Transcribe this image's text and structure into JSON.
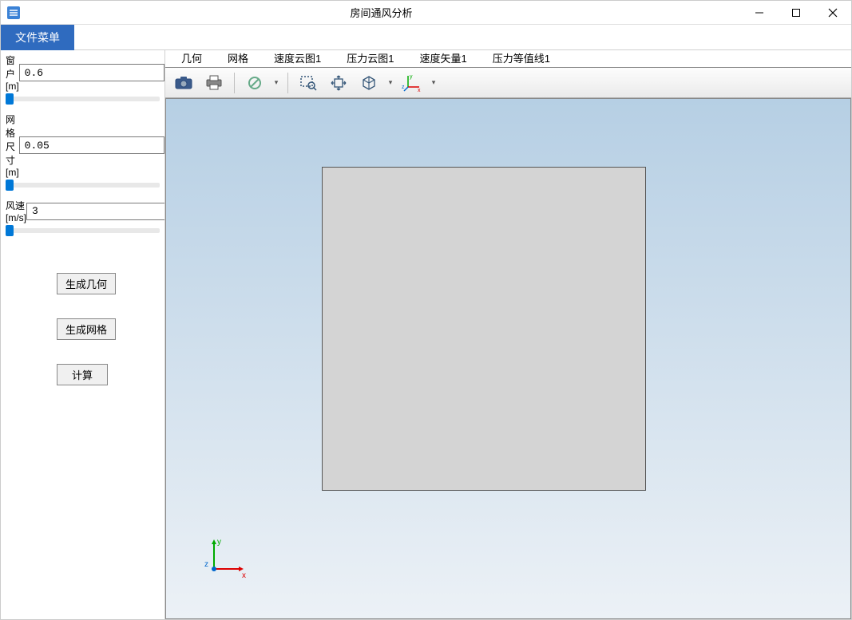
{
  "window": {
    "title": "房间通风分析"
  },
  "menu": {
    "file": "文件菜单"
  },
  "params": {
    "window_label": "窗户[m]",
    "window_value": "0.6",
    "mesh_label": "网格尺寸[m]",
    "mesh_value": "0.05",
    "wind_label": "风速[m/s]",
    "wind_value": "3"
  },
  "buttons": {
    "gen_geom": "生成几何",
    "gen_mesh": "生成网格",
    "compute": "计算"
  },
  "tabs": [
    "几何",
    "网格",
    "速度云图1",
    "压力云图1",
    "速度矢量1",
    "压力等值线1"
  ],
  "axis": {
    "x": "x",
    "y": "y",
    "z": "z"
  }
}
